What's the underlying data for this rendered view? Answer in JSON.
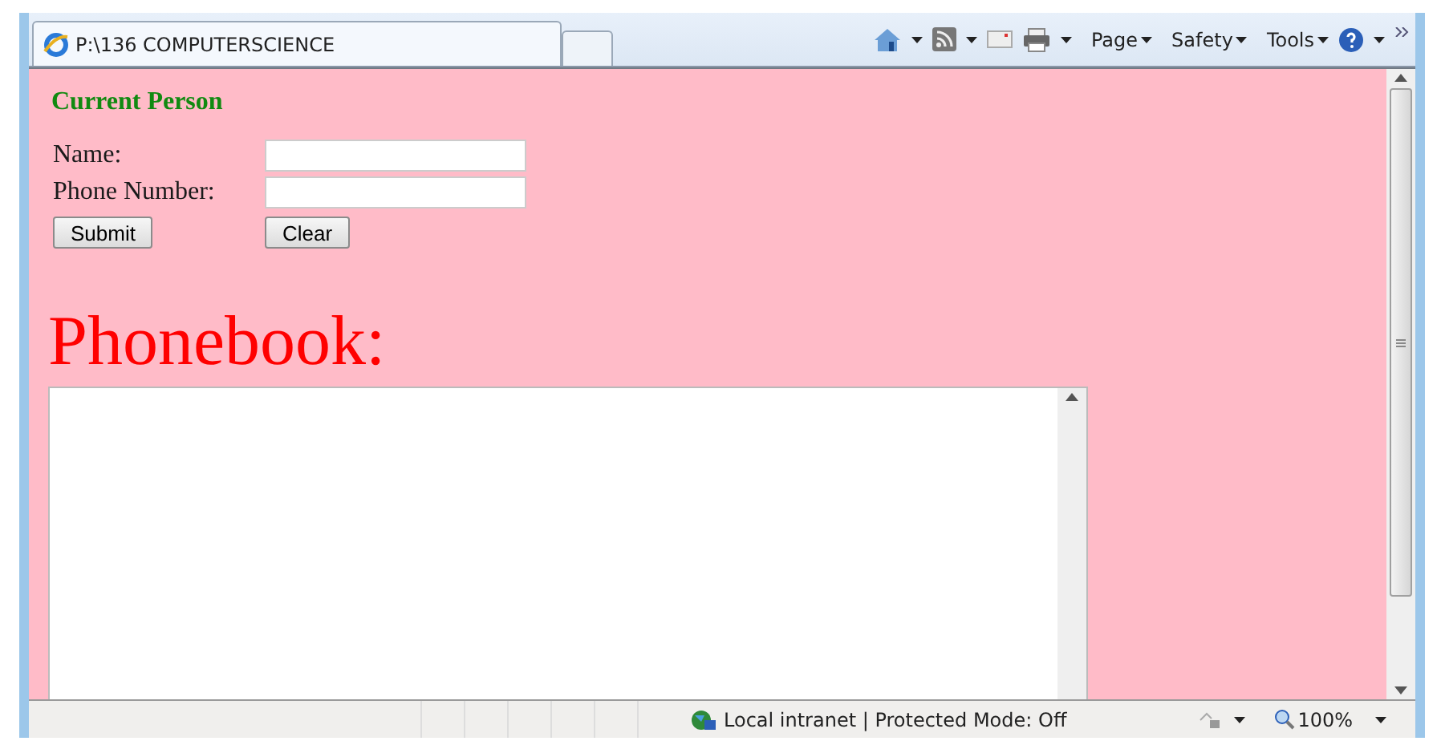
{
  "tab": {
    "title": "P:\\136 COMPUTERSCIENCE",
    "selected": true
  },
  "toolbar": {
    "menus": [
      "Page",
      "Safety",
      "Tools"
    ]
  },
  "form": {
    "heading": "Current Person",
    "fields": [
      {
        "label": "Name:"
      },
      {
        "label": "Phone Number:"
      }
    ],
    "buttons": [
      "Submit",
      "Clear"
    ]
  },
  "phonebook": {
    "title": "Phonebook:"
  },
  "status_bar": {
    "zone": "Local intranet | Protected Mode: Off",
    "zoom": "100%"
  }
}
